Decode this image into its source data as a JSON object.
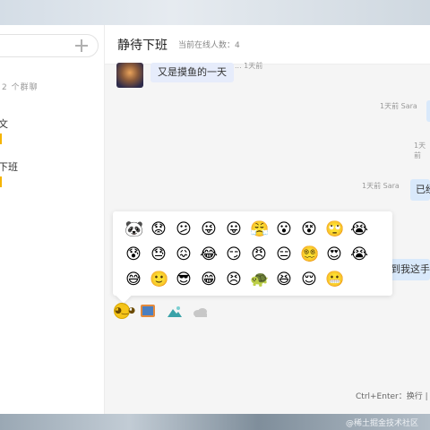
{
  "sidebar": {
    "group_count": "2 个群聊",
    "groups": [
      {
        "name": "文"
      },
      {
        "name": "下班"
      }
    ]
  },
  "chat": {
    "title": "静待下班",
    "online": "当前在线人数：4",
    "messages": {
      "m1_text": "又是摸鱼的一天",
      "m1_meta": "... 1天前",
      "m2_meta": "1天前 Sara",
      "m3_meta": "1天前",
      "m4_meta": "1天前 Sara",
      "m4_text": "已经",
      "m5_text": "到我这手机"
    }
  },
  "emoji_panel": {
    "emojis": [
      "🐼",
      "😟",
      "😕",
      "😜",
      "😛",
      "😤",
      "😮",
      "😵",
      "🙄",
      "😭",
      "😰",
      "😓",
      "😖",
      "😂",
      "😏",
      "😠",
      "😑",
      "😵‍💫",
      "😍",
      "😭",
      "😅",
      "🙂",
      "😎",
      "😁",
      "😣",
      "🐢",
      "😆",
      "😌",
      "😬"
    ]
  },
  "toolbar": {
    "smile_glyph": "◕‿◕",
    "image_icon": "image-icon",
    "scene_icon": "landscape-icon",
    "cloud_icon": "cloud-icon"
  },
  "footer": {
    "hint": "Ctrl+Enter：换行 | E",
    "watermark": "@稀土掘金技术社区"
  }
}
